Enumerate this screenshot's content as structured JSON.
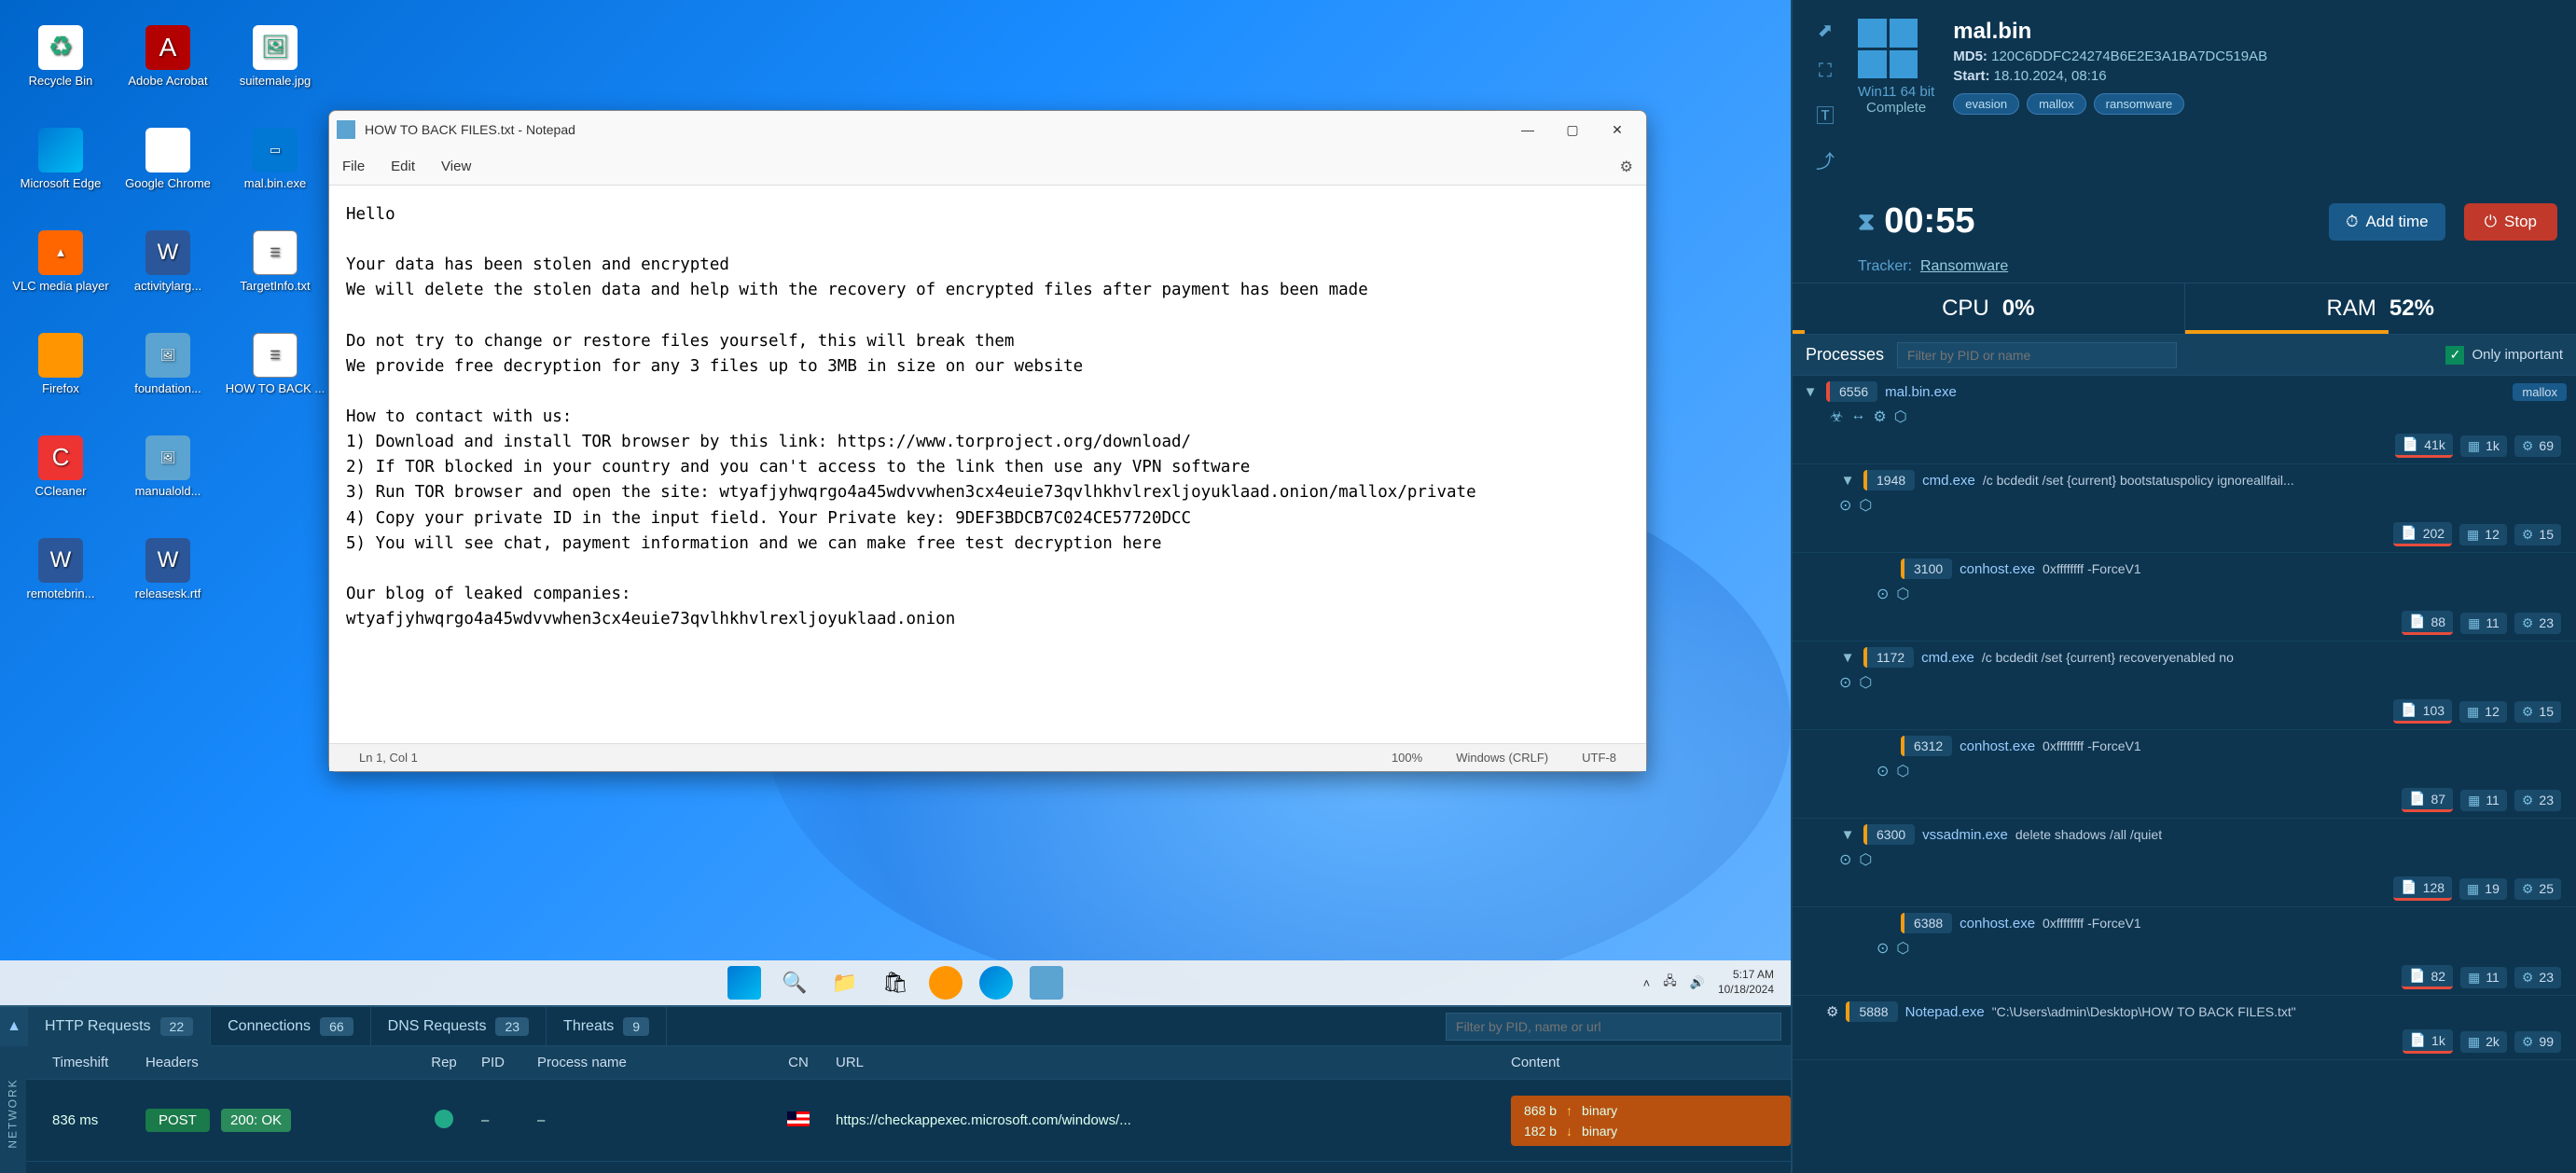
{
  "desktop": {
    "icons": [
      {
        "label": "Recycle Bin",
        "cls": "ico-recycle",
        "glyph": "♻"
      },
      {
        "label": "Adobe Acrobat",
        "cls": "ico-pdf",
        "glyph": "A"
      },
      {
        "label": "suitemale.jpg",
        "cls": "ico-img",
        "glyph": "🖼"
      },
      {
        "label": "Microsoft Edge",
        "cls": "ico-edge",
        "glyph": ""
      },
      {
        "label": "Google Chrome",
        "cls": "ico-chrome",
        "glyph": ""
      },
      {
        "label": "mal.bin.exe",
        "cls": "ico-exe",
        "glyph": "▭"
      },
      {
        "label": "VLC media player",
        "cls": "ico-vlc",
        "glyph": "▲"
      },
      {
        "label": "activitylarg...",
        "cls": "ico-word",
        "glyph": "W"
      },
      {
        "label": "TargetInfo.txt",
        "cls": "ico-txt",
        "glyph": "☰"
      },
      {
        "label": "Firefox",
        "cls": "ico-ff",
        "glyph": ""
      },
      {
        "label": "foundation...",
        "cls": "ico-generic",
        "glyph": "🖼"
      },
      {
        "label": "HOW TO BACK ...",
        "cls": "ico-txt",
        "glyph": "☰"
      },
      {
        "label": "CCleaner",
        "cls": "ico-cc",
        "glyph": "C"
      },
      {
        "label": "manualold...",
        "cls": "ico-generic",
        "glyph": "🖼"
      },
      {
        "label": "",
        "cls": "",
        "glyph": ""
      },
      {
        "label": "remotebrin...",
        "cls": "ico-word",
        "glyph": "W"
      },
      {
        "label": "releasesk.rtf",
        "cls": "ico-word",
        "glyph": "W"
      }
    ]
  },
  "notepad": {
    "title": "HOW TO BACK FILES.txt - Notepad",
    "menu": {
      "file": "File",
      "edit": "Edit",
      "view": "View"
    },
    "body": "Hello\n\nYour data has been stolen and encrypted\nWe will delete the stolen data and help with the recovery of encrypted files after payment has been made\n\nDo not try to change or restore files yourself, this will break them\nWe provide free decryption for any 3 files up to 3MB in size on our website\n\nHow to contact with us:\n1) Download and install TOR browser by this link: https://www.torproject.org/download/\n2) If TOR blocked in your country and you can't access to the link then use any VPN software\n3) Run TOR browser and open the site: wtyafjyhwqrgo4a45wdvvwhen3cx4euie73qvlhkhvlrexljoyuklaad.onion/mallox/private\n4) Copy your private ID in the input field. Your Private key: 9DEF3BDCB7C024CE57720DCC\n5) You will see chat, payment information and we can make free test decryption here\n\nOur blog of leaked companies:\nwtyafjyhwqrgo4a45wdvvwhen3cx4euie73qvlhkhvlrexljoyuklaad.onion",
    "status": {
      "pos": "Ln 1, Col 1",
      "zoom": "100%",
      "eol": "Windows (CRLF)",
      "enc": "UTF-8"
    }
  },
  "taskbar": {
    "time": "5:17 AM",
    "date": "10/18/2024"
  },
  "network": {
    "side_label": "NETWORK",
    "tabs": {
      "http": "HTTP Requests",
      "http_count": "22",
      "conn": "Connections",
      "conn_count": "66",
      "dns": "DNS Requests",
      "dns_count": "23",
      "threats": "Threats",
      "threats_count": "9"
    },
    "filter_placeholder": "Filter by PID, name or url",
    "headers": {
      "ts": "Timeshift",
      "hdr": "Headers",
      "rep": "Rep",
      "pid": "PID",
      "pn": "Process name",
      "cn": "CN",
      "url": "URL",
      "content": "Content"
    },
    "row": {
      "ts": "836 ms",
      "method": "POST",
      "status": "200: OK",
      "pid": "–",
      "pn": "–",
      "url": "https://checkappexec.microsoft.com/windows/...",
      "up_bytes": "868 b",
      "up_type": "binary",
      "down_bytes": "182 b",
      "down_type": "binary"
    }
  },
  "task": {
    "file": "mal.bin",
    "md5_label": "MD5:",
    "md5": "120C6DDFC24274B6E2E3A1BA7DC519AB",
    "start_label": "Start:",
    "start": "18.10.2024, 08:16",
    "os": "Win11 64 bit",
    "os_status": "Complete",
    "tags": [
      "evasion",
      "mallox",
      "ransomware"
    ],
    "timer": "00:55",
    "add_time": "Add time",
    "stop": "Stop",
    "tracker_label": "Tracker:",
    "tracker": "Ransomware",
    "cpu_label": "CPU",
    "cpu": "0%",
    "ram_label": "RAM",
    "ram": "52%"
  },
  "processes": {
    "title": "Processes",
    "filter_placeholder": "Filter by PID or name",
    "only_important": "Only important",
    "tree": [
      {
        "level": 0,
        "pid": "6556",
        "name": "mal.bin.exe",
        "cmd": "",
        "tag": "mallox",
        "danger": true,
        "expand": "▼",
        "indicators": [
          "☣",
          "↔",
          "⚙",
          "⬡"
        ],
        "stats": {
          "files": "41k",
          "reg": "1k",
          "mod": "69"
        }
      },
      {
        "level": 1,
        "pid": "1948",
        "name": "cmd.exe",
        "cmd": "/c bcdedit /set {current} bootstatuspolicy ignoreallfail...",
        "expand": "▼",
        "indicators": [
          "⊙",
          "⬡"
        ],
        "stats": {
          "files": "202",
          "reg": "12",
          "mod": "15"
        }
      },
      {
        "level": 2,
        "pid": "3100",
        "name": "conhost.exe",
        "cmd": "0xffffffff -ForceV1",
        "indicators": [
          "⊙",
          "⬡"
        ],
        "stats": {
          "files": "88",
          "reg": "11",
          "mod": "23"
        }
      },
      {
        "level": 1,
        "pid": "1172",
        "name": "cmd.exe",
        "cmd": "/c bcdedit /set {current} recoveryenabled no",
        "expand": "▼",
        "indicators": [
          "⊙",
          "⬡"
        ],
        "stats": {
          "files": "103",
          "reg": "12",
          "mod": "15"
        }
      },
      {
        "level": 2,
        "pid": "6312",
        "name": "conhost.exe",
        "cmd": "0xffffffff -ForceV1",
        "indicators": [
          "⊙",
          "⬡"
        ],
        "stats": {
          "files": "87",
          "reg": "11",
          "mod": "23"
        }
      },
      {
        "level": 1,
        "pid": "6300",
        "name": "vssadmin.exe",
        "cmd": "delete shadows /all /quiet",
        "expand": "▼",
        "indicators": [
          "⊙",
          "⬡"
        ],
        "stats": {
          "files": "128",
          "reg": "19",
          "mod": "25"
        }
      },
      {
        "level": 2,
        "pid": "6388",
        "name": "conhost.exe",
        "cmd": "0xffffffff -ForceV1",
        "indicators": [
          "⊙",
          "⬡"
        ],
        "stats": {
          "files": "82",
          "reg": "11",
          "mod": "23"
        }
      },
      {
        "level": 0,
        "pid": "5888",
        "name": "Notepad.exe",
        "cmd": "\"C:\\Users\\admin\\Desktop\\HOW TO BACK FILES.txt\"",
        "icon": "⚙",
        "stats": {
          "files": "1k",
          "reg": "2k",
          "mod": "99"
        }
      }
    ]
  }
}
